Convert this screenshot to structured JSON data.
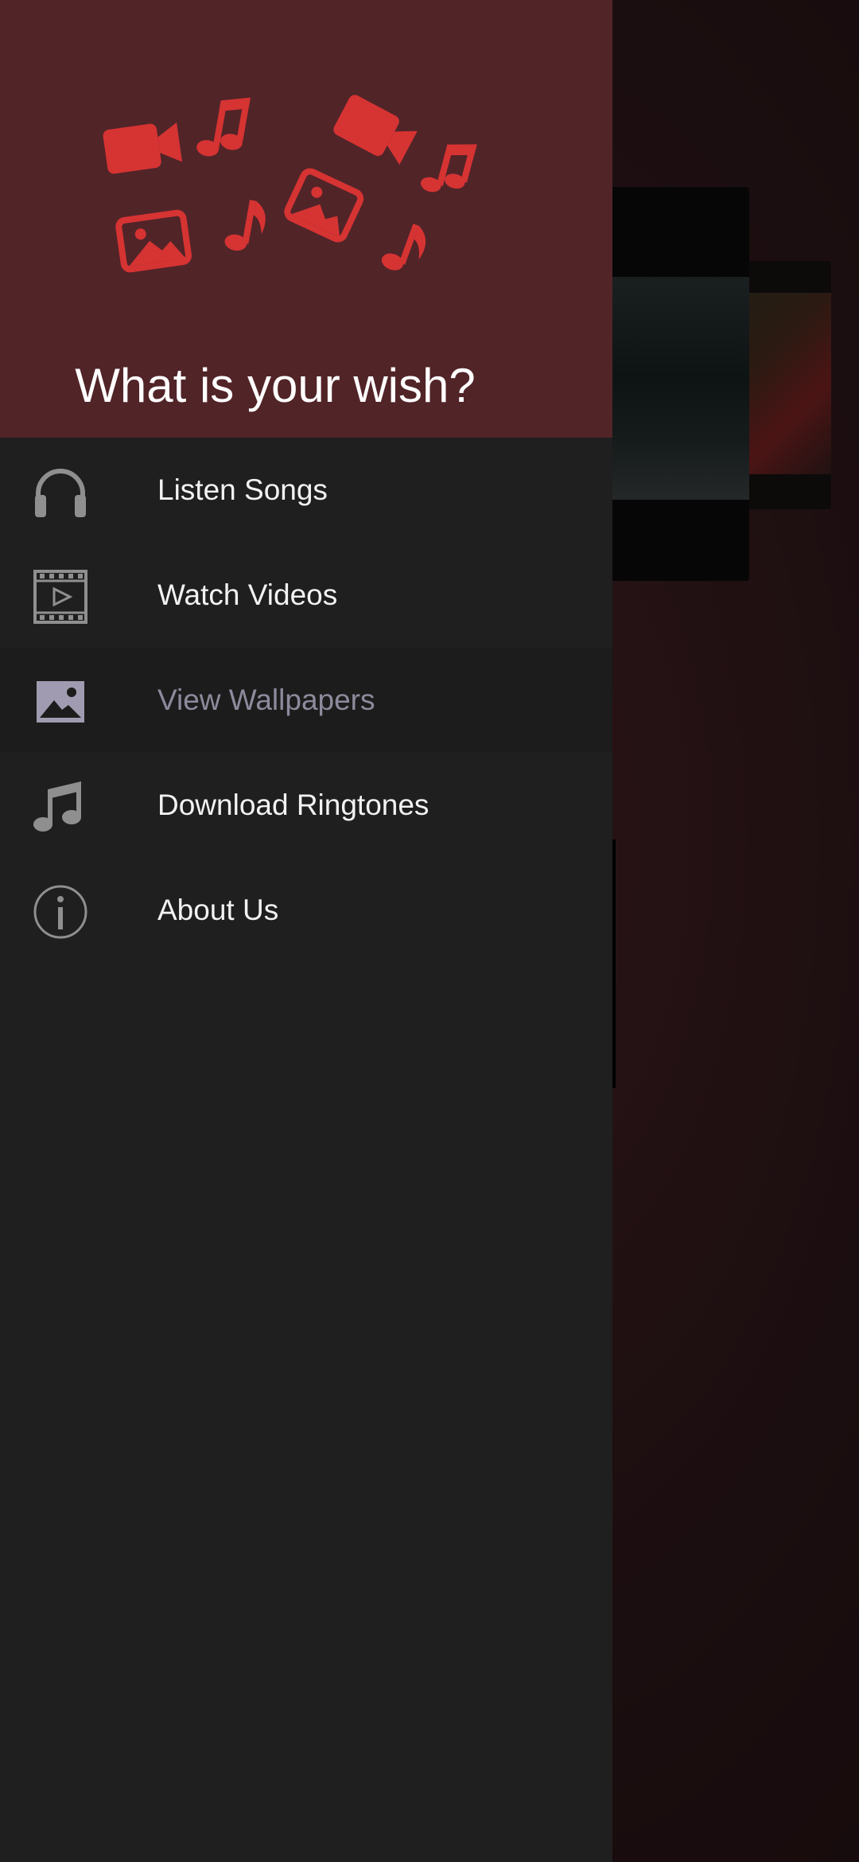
{
  "header": {
    "title": "What is your wish?"
  },
  "menu": {
    "items": [
      {
        "label": "Listen Songs",
        "icon": "headphones-icon",
        "selected": false
      },
      {
        "label": "Watch Videos",
        "icon": "film-play-icon",
        "selected": false
      },
      {
        "label": "View Wallpapers",
        "icon": "image-icon",
        "selected": true
      },
      {
        "label": "Download Ringtones",
        "icon": "music-note-icon",
        "selected": false
      },
      {
        "label": "About Us",
        "icon": "info-icon",
        "selected": false
      }
    ]
  },
  "colors": {
    "header_bg": "#512428",
    "drawer_bg": "#1f1f1f",
    "accent_red": "#d63333",
    "selected_text": "#8e8a9c",
    "icon_gray": "#8f8f8f",
    "selected_icon": "#a09bb0"
  }
}
